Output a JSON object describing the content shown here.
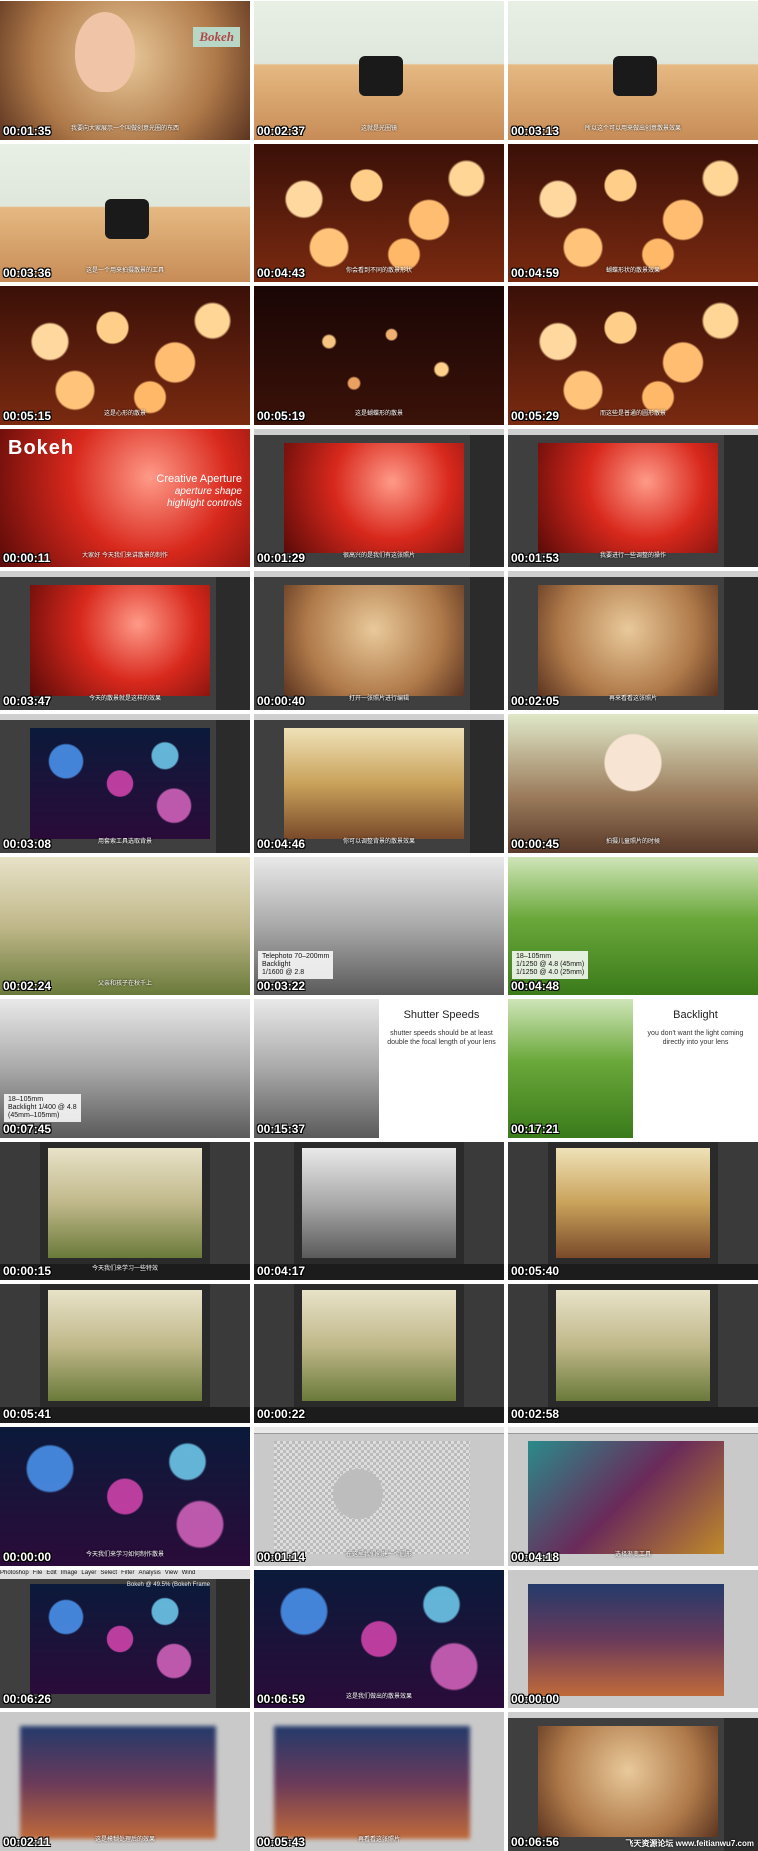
{
  "tiles": [
    {
      "time": "00:01:35",
      "kind": "portrait",
      "text": "Bokeh",
      "sub": "我要向大家展示一个叫做创意光圈的东西",
      "sub2": ""
    },
    {
      "time": "00:02:37",
      "kind": "lens-table",
      "sub": "这就是光圈镜",
      "sub2": ""
    },
    {
      "time": "00:03:13",
      "kind": "lens-table",
      "sub": "所以这个可以用来做出创意散景效果",
      "sub2": ""
    },
    {
      "time": "00:03:36",
      "kind": "lens-hand",
      "sub": "这是一个用来拍摄散景的工具",
      "sub2": ""
    },
    {
      "time": "00:04:43",
      "kind": "bokeh-warm",
      "sub": "你会看到不同的散景形状",
      "sub2": ""
    },
    {
      "time": "00:04:59",
      "kind": "bokeh-warm",
      "sub": "蝴蝶形状的散景效果",
      "sub2": ""
    },
    {
      "time": "00:05:15",
      "kind": "bokeh-warm",
      "sub": "这是心形的散景",
      "sub2": ""
    },
    {
      "time": "00:05:19",
      "kind": "bokeh-dark",
      "sub": "这是蝴蝶形的散景",
      "sub2": ""
    },
    {
      "time": "00:05:29",
      "kind": "bokeh-warm",
      "sub": "而这些是普通的圆形散景",
      "sub2": ""
    },
    {
      "time": "00:00:11",
      "kind": "title",
      "logo": "Bokeh",
      "title1": "Creative Aperture",
      "title2": "aperture shape",
      "title3": "highlight controls",
      "sub": "大家好 今天我们来讲散景的制作",
      "sub2": ""
    },
    {
      "time": "00:01:29",
      "kind": "ps-red",
      "sub": "很高兴的是我们有这张照片",
      "sub2": ""
    },
    {
      "time": "00:01:53",
      "kind": "ps-red-dialog",
      "sub": "我要进行一些调整的操作",
      "sub2": ""
    },
    {
      "time": "00:03:47",
      "kind": "ps-red",
      "sub": "今天的散景就是这样的效果",
      "sub2": ""
    },
    {
      "time": "00:00:40",
      "kind": "ps-portrait",
      "sub": "打开一张照片进行编辑",
      "sub2": ""
    },
    {
      "time": "00:02:05",
      "kind": "ps-portrait",
      "sub": "再来看看这张照片",
      "sub2": ""
    },
    {
      "time": "00:03:08",
      "kind": "ps-bokeh",
      "sub": "用套索工具选取背景",
      "sub2": ""
    },
    {
      "time": "00:04:46",
      "kind": "ps-gold",
      "sub": "你可以调整背景的散景效果",
      "sub2": ""
    },
    {
      "time": "00:00:45",
      "kind": "baby",
      "sub": "拍摄儿童照片的时候",
      "sub2": ""
    },
    {
      "time": "00:02:24",
      "kind": "outdoor",
      "sub": "父亲和孩子在秋千上",
      "sub2": ""
    },
    {
      "time": "00:03:22",
      "kind": "bw-family",
      "caption": "Telephoto 70–200mm\nBacklight\n1/1600 @ 2.8",
      "sub": "",
      "sub2": ""
    },
    {
      "time": "00:04:48",
      "kind": "grass",
      "caption": "18–105mm\n1/1250 @ 4.8 (45mm)\n1/1250 @ 4.0 (25mm)",
      "sub": "",
      "sub2": ""
    },
    {
      "time": "00:07:45",
      "kind": "bw-father",
      "caption": "18–105mm\nBacklight 1/400 @ 4.8\n(45mm–105mm)",
      "sub": "",
      "sub2": ""
    },
    {
      "time": "00:15:37",
      "kind": "shutter",
      "ptitle": "Shutter Speeds",
      "pbody": "shutter speeds should be at least double the focal length of your lens",
      "sub": "",
      "sub2": ""
    },
    {
      "time": "00:17:21",
      "kind": "backlight",
      "ptitle": "Backlight",
      "pbody": "you don't want the light coming directly into your lens",
      "sub": "",
      "sub2": ""
    },
    {
      "time": "00:00:15",
      "kind": "lr-girl",
      "sub": "今天我们来学习一些特效",
      "sub2": ""
    },
    {
      "time": "00:04:17",
      "kind": "lr-bw",
      "sub": "",
      "sub2": ""
    },
    {
      "time": "00:05:40",
      "kind": "lr-field",
      "sub": "",
      "sub2": ""
    },
    {
      "time": "00:05:41",
      "kind": "lr-pregnant",
      "sub": "",
      "sub2": ""
    },
    {
      "time": "00:00:22",
      "kind": "lr-compare",
      "sub": "",
      "sub2": ""
    },
    {
      "time": "00:02:58",
      "kind": "lr-compare-girl",
      "sub": "",
      "sub2": ""
    },
    {
      "time": "00:00:00",
      "kind": "bokeh-color",
      "sub": "今天我们来学习如何制作散景",
      "sub2": ""
    },
    {
      "time": "00:01:14",
      "kind": "mac-circle",
      "sub": "在这里我们创建一个圆形",
      "sub2": ""
    },
    {
      "time": "00:04:18",
      "kind": "mac-gradient",
      "sub": "选择渐变工具",
      "sub2": ""
    },
    {
      "time": "00:06:26",
      "kind": "ps-menu",
      "menubar": [
        "Photoshop",
        "File",
        "Edit",
        "Image",
        "Layer",
        "Select",
        "Filter",
        "Analysis",
        "View",
        "Wind"
      ],
      "doc": "Bokeh @ 49.5% (Bokeh Frame",
      "sub": "",
      "sub2": ""
    },
    {
      "time": "00:06:59",
      "kind": "bokeh-color",
      "sub": "这是我们做出的散景效果",
      "sub2": ""
    },
    {
      "time": "00:00:00",
      "kind": "street",
      "sub": "",
      "sub2": ""
    },
    {
      "time": "00:02:11",
      "kind": "street-blur",
      "sub": "这是模糊处理后的效果",
      "sub2": ""
    },
    {
      "time": "00:05:43",
      "kind": "street-blur",
      "sub": "再看看这张照片",
      "sub2": ""
    },
    {
      "time": "00:06:56",
      "kind": "ps-women",
      "sub": "",
      "sub2": ""
    }
  ],
  "watermark": "飞天资源论坛 www.feitianwu7.com"
}
